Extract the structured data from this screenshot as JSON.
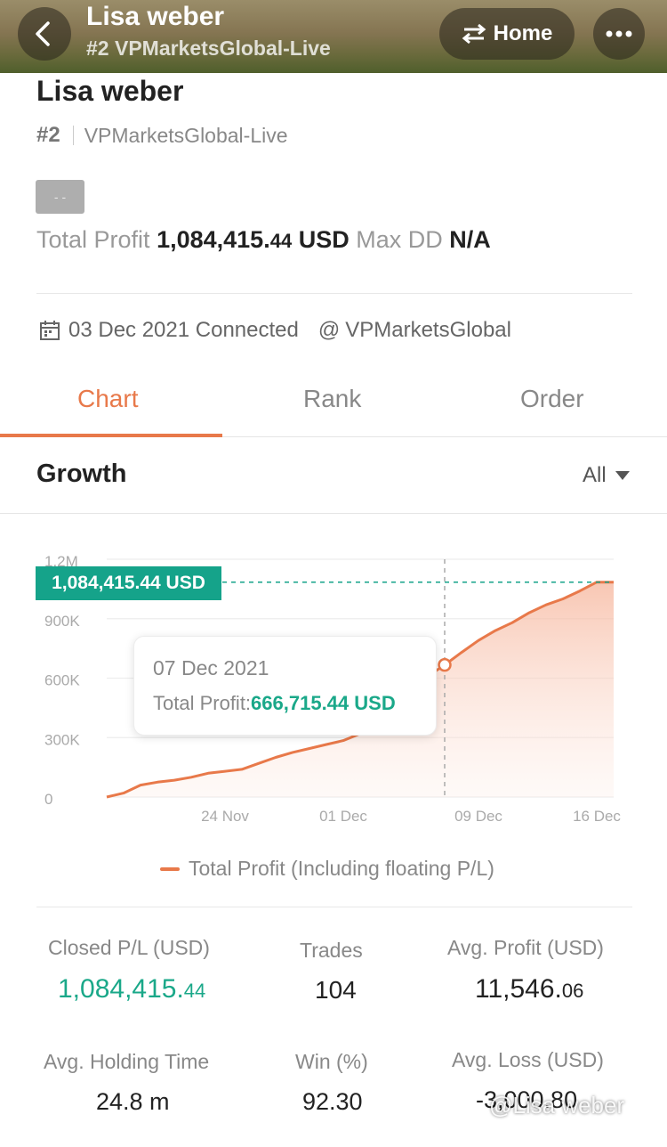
{
  "header": {
    "title": "Lisa weber",
    "subtitle": "#2 VPMarketsGlobal-Live",
    "home_label": "Home",
    "back_icon": "chevron-left-icon",
    "switch_icon": "swap-arrows-icon",
    "more_icon": "more-dots-icon"
  },
  "profile": {
    "name": "Lisa weber",
    "rank": "#2",
    "server": "VPMarketsGlobal-Live",
    "tag": "- -",
    "total_profit_label": "Total Profit",
    "total_profit_int": "1,084,415.",
    "total_profit_dec": "44",
    "total_profit_unit": "USD",
    "max_dd_label": "Max DD",
    "max_dd_value": "N/A",
    "connected_text": "03 Dec 2021 Connected",
    "broker_at": "@",
    "broker": "VPMarketsGlobal"
  },
  "tabs": [
    {
      "label": "Chart",
      "active": true
    },
    {
      "label": "Rank",
      "active": false
    },
    {
      "label": "Order",
      "active": false
    }
  ],
  "growth": {
    "title": "Growth",
    "filter": "All"
  },
  "chart_data": {
    "type": "area",
    "y_ticks": [
      "1.2M",
      "900K",
      "600K",
      "300K",
      "0"
    ],
    "y_tick_values": [
      1200000,
      900000,
      600000,
      300000,
      0
    ],
    "x_ticks": [
      "24 Nov",
      "01 Dec",
      "09 Dec",
      "16 Dec"
    ],
    "ylim": [
      0,
      1200000
    ],
    "series": [
      {
        "name": "Total Profit (Including floating P/L)",
        "color": "#e8794a",
        "x": [
          "17 Nov",
          "18 Nov",
          "19 Nov",
          "20 Nov",
          "21 Nov",
          "22 Nov",
          "23 Nov",
          "24 Nov",
          "25 Nov",
          "26 Nov",
          "27 Nov",
          "28 Nov",
          "29 Nov",
          "30 Nov",
          "01 Dec",
          "02 Dec",
          "03 Dec",
          "04 Dec",
          "05 Dec",
          "06 Dec",
          "07 Dec",
          "08 Dec",
          "09 Dec",
          "10 Dec",
          "11 Dec",
          "12 Dec",
          "13 Dec",
          "14 Dec",
          "15 Dec",
          "16 Dec",
          "17 Dec"
        ],
        "y": [
          0,
          20000,
          60000,
          75000,
          85000,
          100000,
          120000,
          130000,
          140000,
          170000,
          200000,
          225000,
          245000,
          265000,
          285000,
          320000,
          380000,
          460000,
          540000,
          610000,
          666715,
          730000,
          790000,
          840000,
          880000,
          930000,
          970000,
          1000000,
          1040000,
          1084415,
          1084415
        ]
      }
    ],
    "highlight": {
      "date": "07 Dec 2021",
      "label": "Total Profit:",
      "value": "666,715.44 USD"
    },
    "current_value_label": "1,084,415.44 USD",
    "grid": true,
    "legend_position": "bottom"
  },
  "stats": {
    "closed_pl_label": "Closed P/L (USD)",
    "closed_pl_int": "1,084,415.",
    "closed_pl_dec": "44",
    "trades_label": "Trades",
    "trades_value": "104",
    "avg_profit_label": "Avg. Profit (USD)",
    "avg_profit_int": "11,546.",
    "avg_profit_dec": "06",
    "avg_holding_label": "Avg. Holding Time",
    "avg_holding_value": "24.8 m",
    "win_label": "Win (%)",
    "win_value": "92.30",
    "avg_loss_label": "Avg. Loss (USD)",
    "avg_loss_value": "-3,000.80"
  },
  "watermark": "@Lisa weber",
  "colors": {
    "accent": "#e8794a",
    "green": "#15a38a"
  }
}
